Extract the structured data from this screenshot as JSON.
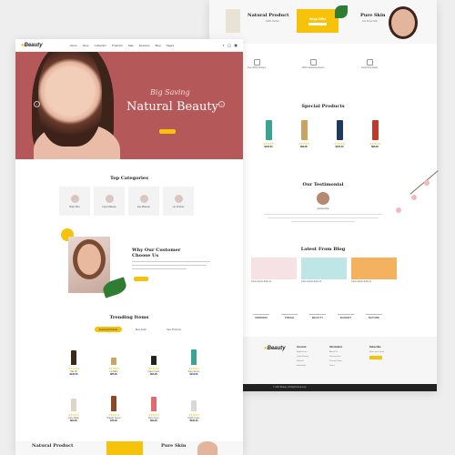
{
  "brand": {
    "logo_prefix": "",
    "logo_main": "Beauty"
  },
  "nav": [
    "Home",
    "Shop",
    "Collection",
    "Products",
    "Sale",
    "Features",
    "Blog",
    "Pages"
  ],
  "hero": {
    "subtitle": "Big Saving",
    "title": "Natural Beauty"
  },
  "categories": {
    "title": "Top Categories",
    "items": [
      {
        "label": "Body Mist"
      },
      {
        "label": "Face Makeup"
      },
      {
        "label": "Eye Makeup"
      },
      {
        "label": "Lip Product"
      }
    ]
  },
  "why": {
    "title": "Why Our Customer Choose Us"
  },
  "trending": {
    "title": "Trending Items",
    "tabs": [
      "Featured Products",
      "Best Seller",
      "New Products"
    ],
    "products": [
      {
        "name": "Hair Oil",
        "price": "$120.00",
        "color": "#3a2a1c",
        "h": 16
      },
      {
        "name": "Lip Balm",
        "price": "$85.00",
        "color": "#c9a465",
        "h": 8
      },
      {
        "name": "Face Cream",
        "price": "$95.00",
        "color": "#222222",
        "h": 10
      },
      {
        "name": "Face Serum",
        "price": "$110.00",
        "color": "#3aa394",
        "h": 17
      },
      {
        "name": "Face Wash",
        "price": "$60.00",
        "color": "#e0d6c8",
        "h": 14
      },
      {
        "name": "Organic Serum",
        "price": "$75.00",
        "color": "#8a4a25",
        "h": 17
      },
      {
        "name": "Rose Toner",
        "price": "$90.00",
        "color": "#e06a72",
        "h": 16
      },
      {
        "name": "Night Cream",
        "price": "$130.00",
        "color": "#d8d8d8",
        "h": 12
      }
    ]
  },
  "bottom_banners": {
    "left": "Natural Product",
    "right": "Pure Skin"
  },
  "top_banners": {
    "left": "Natural Product",
    "left_sub": "100% Herbal",
    "mega": "Mega Offer",
    "right": "Pure Skin",
    "right_sub": "Get Smart Skin"
  },
  "features": [
    "Free World Delivery",
    "100% Guarantee Return",
    "Great Daily Deals"
  ],
  "special": {
    "title": "Special Products",
    "items": [
      {
        "price": "$120.00",
        "color": "#3aa394"
      },
      {
        "price": "$99.00",
        "color": "#c9a465"
      },
      {
        "price": "$105.00",
        "color": "#1e3a5f"
      },
      {
        "price": "$88.00",
        "color": "#c0392b"
      }
    ]
  },
  "testimonial": {
    "title": "Our Testimonial",
    "name": "Jessica Doe"
  },
  "blog": {
    "title": "Latest From Blog",
    "posts": [
      {
        "caption": "Lorem ipsum dolor sit",
        "color": "#f6e1e4"
      },
      {
        "caption": "Lorem ipsum dolor sit",
        "color": "#bfe6e6"
      },
      {
        "caption": "Lorem ipsum dolor sit",
        "color": "#f4b25e"
      }
    ]
  },
  "brands": [
    "MODERN",
    "FRESH",
    "BEAUTY",
    "BAKERY",
    "NATURE"
  ],
  "footer": {
    "logo": "Beauty",
    "cols": [
      {
        "head": "Account",
        "links": [
          "My Account",
          "Order History",
          "Wishlist",
          "Newsletter"
        ]
      },
      {
        "head": "Information",
        "links": [
          "About Us",
          "Delivery Info",
          "Privacy Policy",
          "Terms"
        ]
      },
      {
        "head": "Subscribe",
        "links": [
          "Enter your email"
        ]
      }
    ],
    "copyright": "© 2024 Beauty. All Rights Reserved."
  },
  "colors": {
    "accent": "#f7c20a",
    "hero_bg": "#b5585a"
  }
}
